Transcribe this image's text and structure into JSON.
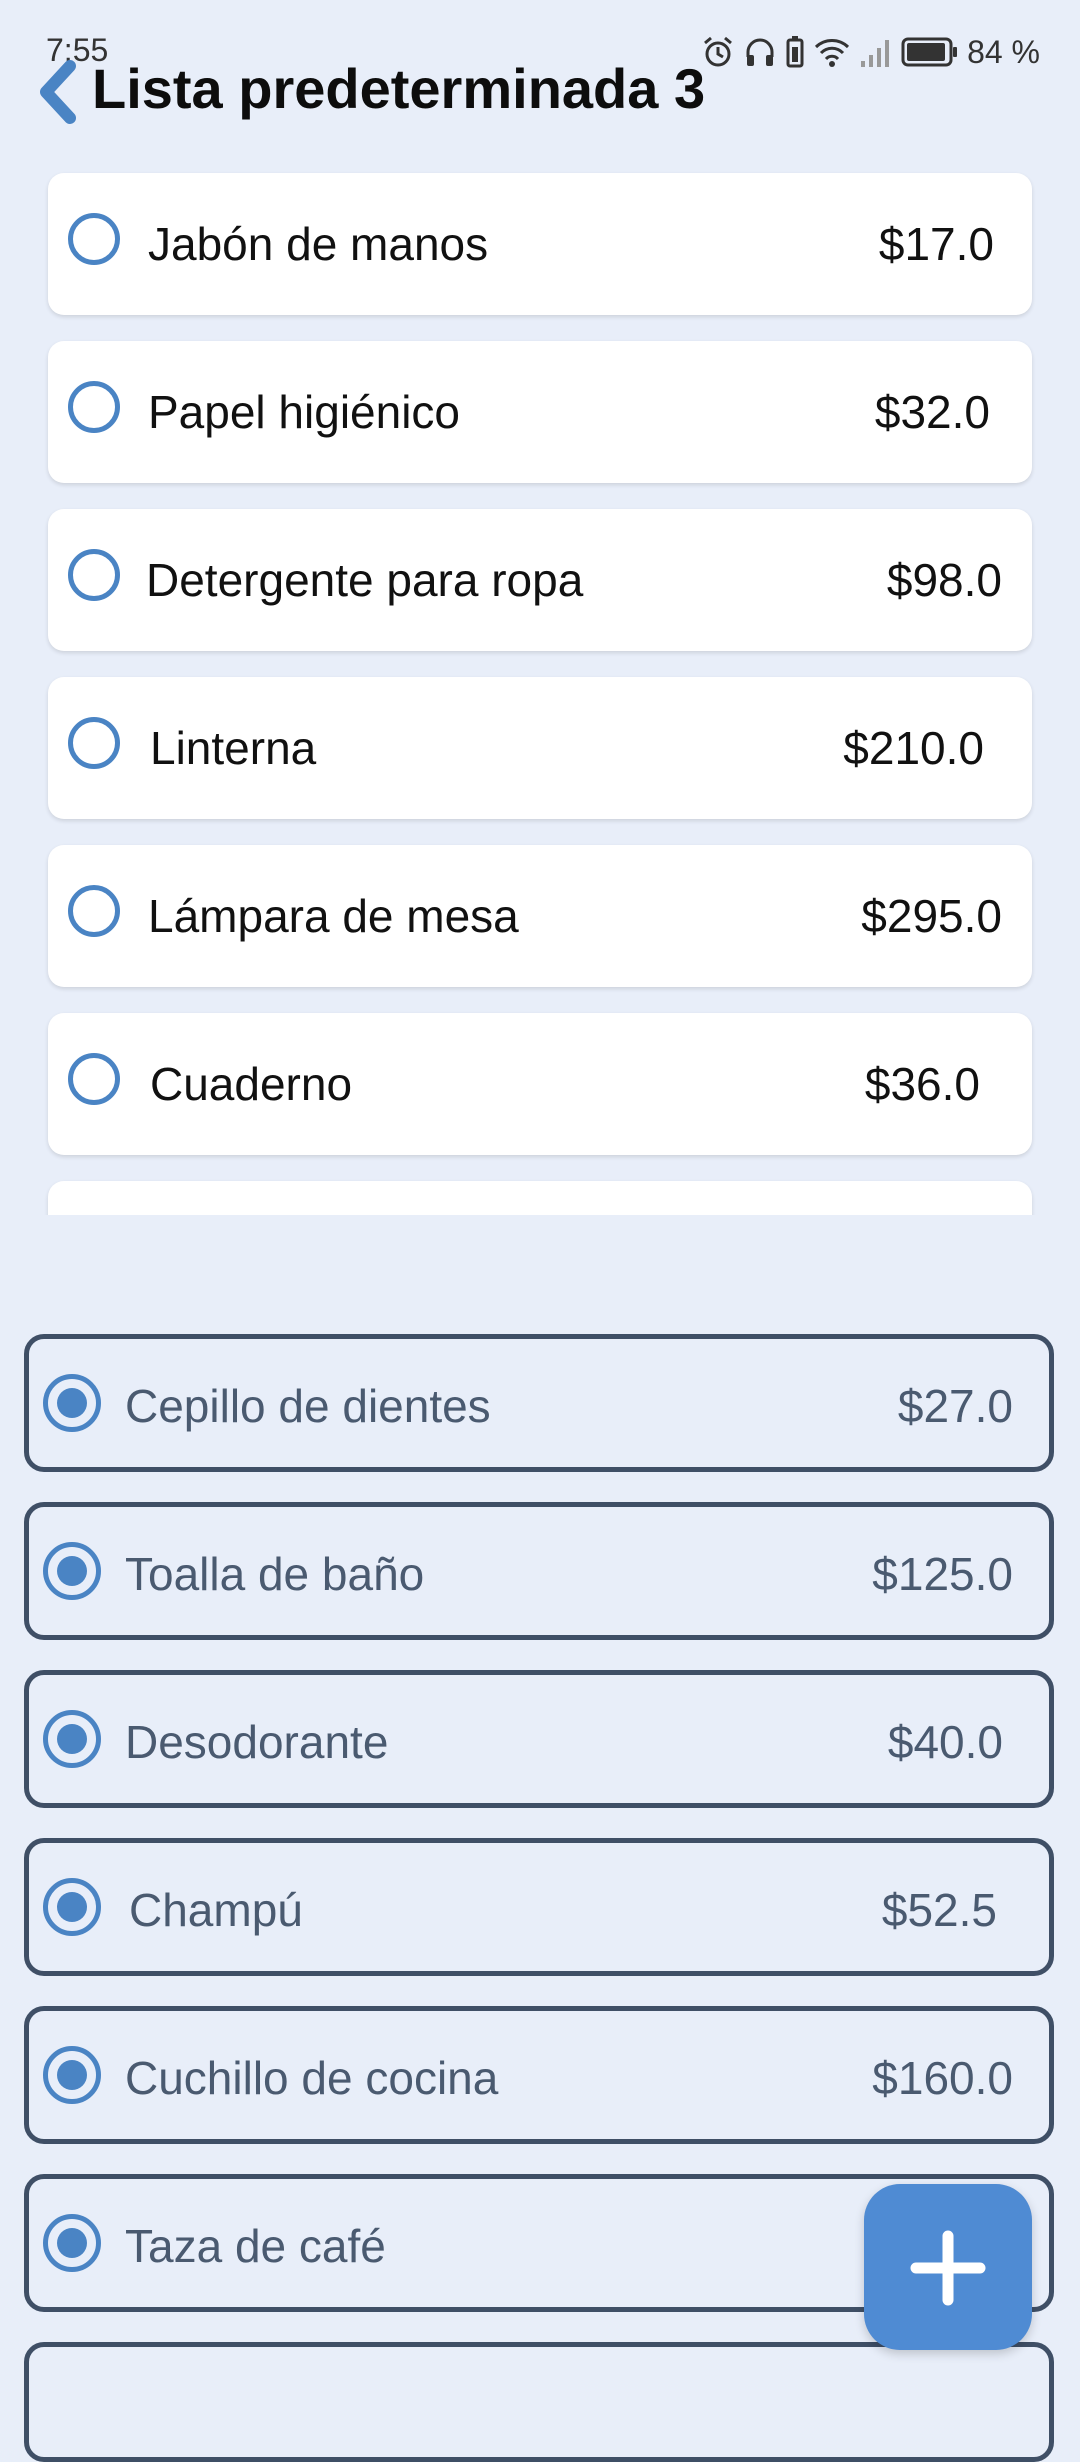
{
  "status_bar": {
    "time": "7:55",
    "battery": "84 %",
    "icons": [
      "alarm-icon",
      "headphones-icon",
      "battery-saver-icon",
      "wifi-icon",
      "signal-icon",
      "battery-icon"
    ]
  },
  "header": {
    "title": "Lista predeterminada 3",
    "back_icon": "chevron-left-icon"
  },
  "pending_items": [
    {
      "name": "Jabón de manos",
      "price": "$17.0"
    },
    {
      "name": "Papel higiénico",
      "price": "$32.0"
    },
    {
      "name": "Detergente para ropa",
      "price": "$98.0"
    },
    {
      "name": "Linterna",
      "price": "$210.0"
    },
    {
      "name": "Lámpara de mesa",
      "price": "$295.0"
    },
    {
      "name": "Cuaderno",
      "price": "$36.0"
    }
  ],
  "checked_items": [
    {
      "name": "Cepillo de dientes",
      "price": "$27.0"
    },
    {
      "name": "Toalla de baño",
      "price": "$125.0"
    },
    {
      "name": "Desodorante",
      "price": "$40.0"
    },
    {
      "name": "Champú",
      "price": "$52.5"
    },
    {
      "name": "Cuchillo de cocina",
      "price": "$160.0"
    },
    {
      "name": "Taza de café",
      "price": ""
    }
  ],
  "fab": {
    "icon": "plus-icon"
  },
  "colors": {
    "background": "#e8eef9",
    "accent": "#4f8bd3",
    "radio": "#4a84c4",
    "checked_border": "#3f4f66",
    "checked_text": "#4a5a70"
  }
}
